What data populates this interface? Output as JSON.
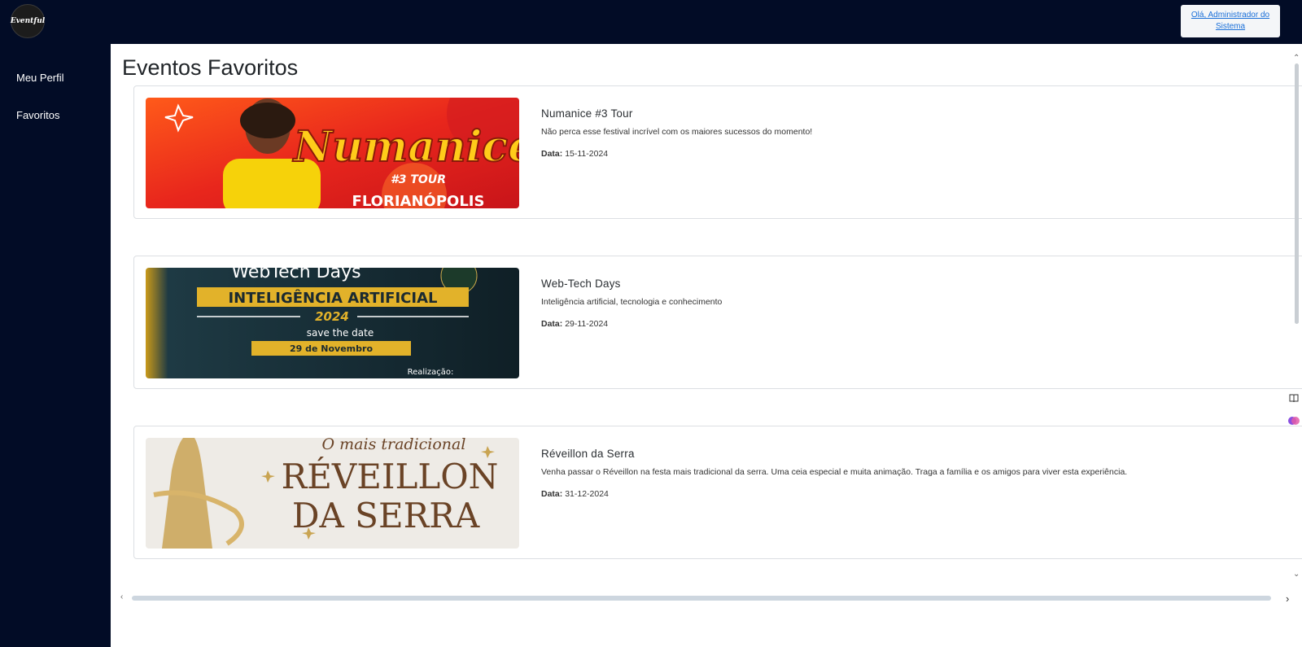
{
  "app": {
    "logo_text": "Eventful",
    "user_greeting": "Olá, Administrador do Sistema"
  },
  "sidebar": {
    "items": [
      {
        "label": "Meu Perfil"
      },
      {
        "label": "Favoritos"
      }
    ]
  },
  "main": {
    "title": "Eventos Favoritos",
    "date_label": "Data:",
    "events": [
      {
        "title": "Numanice #3 Tour",
        "description": "Não perca esse festival incrível com os maiores sucessos do momento!",
        "date": "15-11-2024",
        "image_text": {
          "headline": "Numanice",
          "sub": "#3 TOUR",
          "city": "FLORIANÓPOLIS"
        }
      },
      {
        "title": "Web-Tech Days",
        "description": "Inteligência artificial, tecnologia e conhecimento",
        "date": "29-11-2024",
        "image_text": {
          "headline": "WebTech Days",
          "banner": "INTELIGÊNCIA ARTIFICIAL",
          "year": "2024",
          "save": "save the date",
          "day": "29 de Novembro",
          "footer": "Realização:"
        }
      },
      {
        "title": "Réveillon da Serra",
        "description": "Venha passar o Réveillon na festa mais tradicional da serra. Uma ceia especial e muita animação. Traga a família e os amigos para viver esta experiência.",
        "date": "31-12-2024",
        "image_text": {
          "script": "O mais tradicional",
          "line1": "RÉVEILLON",
          "line2": "DA SERRA"
        }
      }
    ]
  },
  "colors": {
    "navy": "#020c26",
    "link": "#1a6fd8",
    "card_border": "#dcdfe3"
  }
}
